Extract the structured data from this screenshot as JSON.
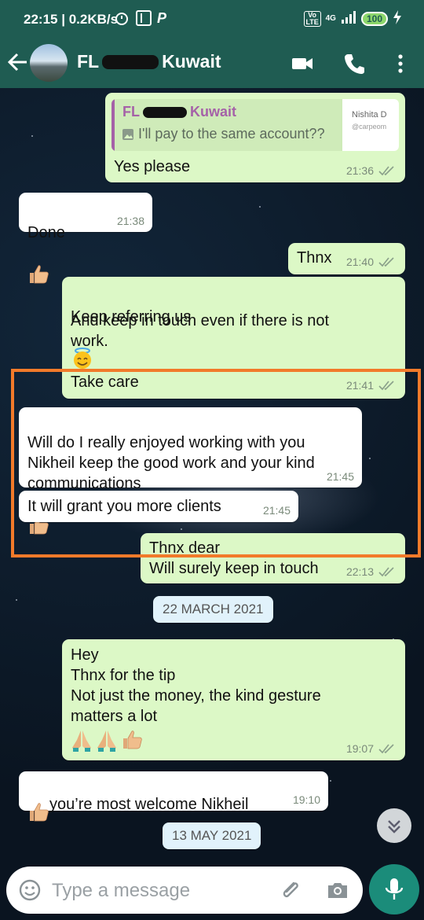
{
  "status_bar": {
    "time": "22:15",
    "speed": "0.2KB/s",
    "network": "4G",
    "volte": "Vo LTE",
    "battery": "100"
  },
  "header": {
    "contact_name_start": "FL",
    "contact_name_end": "Kuwait",
    "icons": [
      "back-arrow-icon",
      "video-call-icon",
      "phone-icon",
      "more-vert-icon"
    ]
  },
  "messages": [
    {
      "type": "out",
      "quote": {
        "name_start": "FL",
        "name_end": "Kuwait",
        "text": "I'll pay to the same account??",
        "thumb_line1": "Nishita D",
        "thumb_line2": "@carpeom"
      },
      "text": "Yes please",
      "time": "21:36"
    },
    {
      "type": "in",
      "text": "Done",
      "emoji": "thumbs-up",
      "time": "21:38"
    },
    {
      "type": "out",
      "text": "Thnx",
      "time": "21:40"
    },
    {
      "type": "out",
      "text": "Keep referring us",
      "emoji": "smiling-face-with-halo",
      "text2": "And keep in touch even if there is not\nwork.",
      "time": ""
    },
    {
      "type": "out",
      "text": "Take care",
      "time": "21:41"
    },
    {
      "type": "in",
      "text": "Will do I really enjoyed working with you\nNikheil keep the good work and your kind\ncommunications",
      "emoji": "thumbs-up",
      "time": "21:45"
    },
    {
      "type": "in",
      "text": "It will grant you more clients",
      "time": "21:45"
    },
    {
      "type": "out",
      "text": "Thnx dear\nWill surely keep in touch",
      "time": "22:13"
    },
    {
      "type": "date",
      "text": "22 MARCH 2021"
    },
    {
      "type": "out",
      "text": "Hey\nThnx for the tip\nNot just the money, the kind gesture\nmatters a lot",
      "emoji": "pray pray thumbs-up",
      "time": "19:07"
    },
    {
      "type": "in",
      "text": "you’re most welcome Nikheil",
      "emoji": "thumbs-up",
      "time": "19:10"
    },
    {
      "type": "date",
      "text": "13 MAY 2021"
    }
  ],
  "input": {
    "placeholder": "Type a message"
  },
  "colors": {
    "header": "#1f5c52",
    "outgoing": "#dcf8c6",
    "incoming": "#ffffff",
    "highlight": "#f27a2a",
    "mic": "#1b8c7a",
    "ticks": "#8aa08a"
  }
}
